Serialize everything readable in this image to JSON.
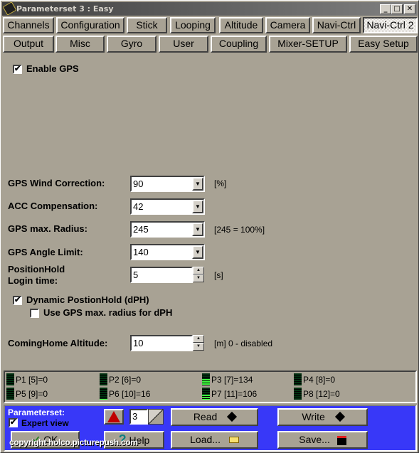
{
  "window": {
    "title": "Parameterset 3 : Easy",
    "controls": [
      "minimize",
      "maximize",
      "close"
    ]
  },
  "tabs_row1": [
    {
      "label": "Channels"
    },
    {
      "label": "Configuration"
    },
    {
      "label": "Stick"
    },
    {
      "label": "Looping"
    },
    {
      "label": "Altitude"
    },
    {
      "label": "Camera"
    },
    {
      "label": "Navi-Ctrl"
    },
    {
      "label": "Navi-Ctrl 2",
      "active": true
    }
  ],
  "tabs_row2": [
    {
      "label": "Output"
    },
    {
      "label": "Misc"
    },
    {
      "label": "Gyro"
    },
    {
      "label": "User"
    },
    {
      "label": "Coupling"
    },
    {
      "label": "Mixer-SETUP"
    },
    {
      "label": "Easy Setup"
    }
  ],
  "enable_gps": {
    "label": "Enable GPS",
    "checked": true
  },
  "fields": {
    "wind_correction": {
      "label": "GPS Wind Correction:",
      "value": "90",
      "unit": "[%]"
    },
    "acc_compensation": {
      "label": "ACC Compensation:",
      "value": "42",
      "unit": ""
    },
    "max_radius": {
      "label": "GPS max. Radius:",
      "value": "245",
      "unit": "[245 = 100%]"
    },
    "angle_limit": {
      "label": "GPS Angle Limit:",
      "value": "140",
      "unit": ""
    },
    "login_time": {
      "label_line1": "PositionHold",
      "label_line2": "Login time:",
      "value": "5",
      "unit": "[s]"
    },
    "coming_home": {
      "label": "ComingHome Altitude:",
      "value": "10",
      "unit": "[m]  0 - disabled"
    }
  },
  "dph": {
    "label": "Dynamic PostionHold (dPH)",
    "checked": true
  },
  "use_max_radius": {
    "label": "Use GPS max. radius for dPH",
    "checked": false
  },
  "poti": [
    {
      "label": "P1 [5]=0",
      "level": 0
    },
    {
      "label": "P2 [6]=0",
      "level": 0
    },
    {
      "label": "P3 [7]=134",
      "level": 0.53
    },
    {
      "label": "P4 [8]=0",
      "level": 0
    },
    {
      "label": "P5 [9]=0",
      "level": 0
    },
    {
      "label": "P6 [10]=16",
      "level": 0.06
    },
    {
      "label": "P7 [11]=106",
      "level": 0.42
    },
    {
      "label": "P8 [12]=0",
      "level": 0
    }
  ],
  "bottom": {
    "parameterset_label": "Parameterset:",
    "expert_view": {
      "label": "Expert view",
      "checked": true
    },
    "set_number": "3",
    "ok": "OK",
    "help": "Help",
    "read": "Read",
    "write": "Write",
    "load": "Load...",
    "save": "Save...",
    "watermark": "copyright holco.picturepush.com"
  },
  "symbols": {
    "check": "✔",
    "minimize": "_",
    "maximize": "□",
    "close": "✕",
    "down": "▼",
    "up": "▲",
    "warning": "!",
    "help": "?",
    "ok": "✓"
  }
}
